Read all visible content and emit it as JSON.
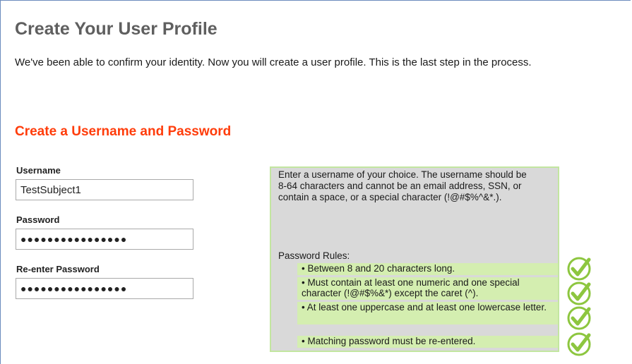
{
  "page": {
    "title": "Create Your User Profile",
    "intro": "We've been able to confirm your identity. Now you will create a user profile. This is the last step in the process."
  },
  "section": {
    "title": "Create a Username and Password"
  },
  "form": {
    "username": {
      "label": "Username",
      "value": "TestSubject1"
    },
    "password": {
      "label": "Password",
      "value": "●●●●●●●●●●●●●●●●"
    },
    "confirm_password": {
      "label": "Re-enter Password",
      "value": "●●●●●●●●●●●●●●●●"
    }
  },
  "help": {
    "username_text": "Enter a username of your choice. The username should be 8-64 characters and cannot be an email address, SSN, or contain a space, or a special character (!@#$%^&*.).",
    "rules_heading": "Password Rules:",
    "rules": [
      {
        "line1": "• Between 8 and 20 characters long.",
        "line2": "",
        "status": "passed",
        "icon": "check-circle-icon"
      },
      {
        "line1": "• Must contain at least one numeric and one special character (!@#$%&*) except the caret (^).",
        "line2": "",
        "status": "passed",
        "icon": "check-circle-icon"
      },
      {
        "line1": "• At least one uppercase and at least one lowercase letter.",
        "line2": "",
        "status": "passed",
        "icon": "check-circle-icon"
      },
      {
        "line1": "• Matching password must be re-entered.",
        "line2": "",
        "status": "passed",
        "icon": "check-circle-icon"
      }
    ]
  },
  "colors": {
    "title": "#5f5f5f",
    "section_title": "#ff3c0a",
    "help_bg": "#d9d9d9",
    "rule_bg": "#d4eeb0",
    "check": "#8dc63f"
  }
}
